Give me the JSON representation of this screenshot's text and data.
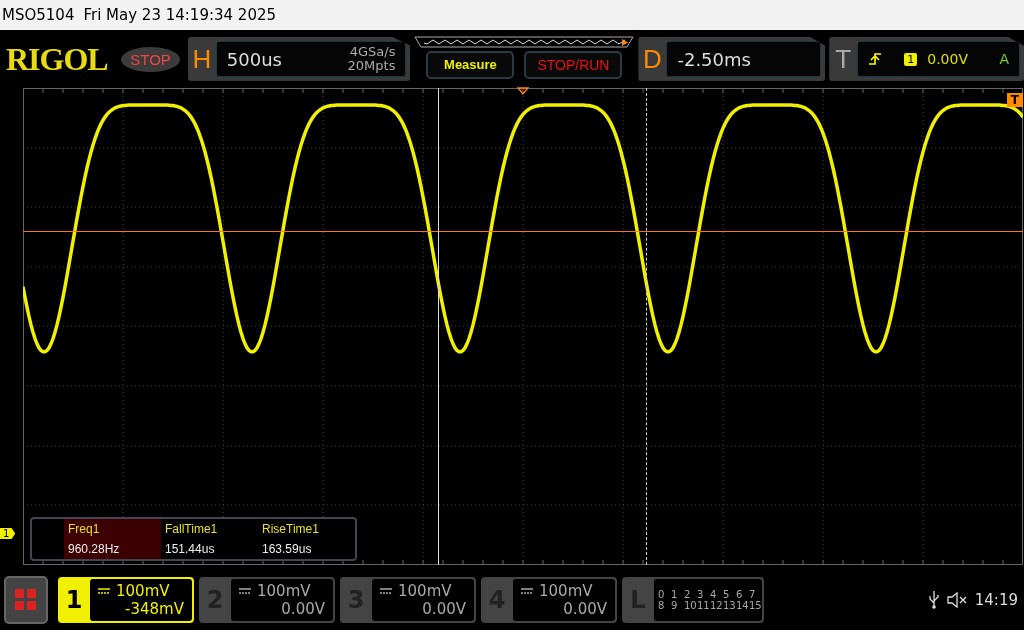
{
  "title_bar": {
    "model": "MSO5104",
    "datetime": "Fri May 23 14:19:34 2025"
  },
  "header": {
    "logo": "RIGOL",
    "run_state": "STOP",
    "horizontal": {
      "label": "H",
      "timebase": "500us",
      "sample_rate": "4GSa/s",
      "memory": "20Mpts"
    },
    "measure_button": "Measure",
    "stop_run_button": "STOP/RUN",
    "delay": {
      "label": "D",
      "value": "-2.50ms"
    },
    "trigger": {
      "label": "T",
      "source": "1",
      "level": "0.00V",
      "mode": "A"
    }
  },
  "screen": {
    "channel_marker": "1",
    "trigger_marker": "T"
  },
  "measurements": [
    {
      "name": "Freq1",
      "value": "960.28Hz",
      "selected": true
    },
    {
      "name": "FallTime1",
      "value": "151.44us",
      "selected": false
    },
    {
      "name": "RiseTime1",
      "value": "163.59us",
      "selected": false
    }
  ],
  "channels": [
    {
      "number": "1",
      "scale": "100mV",
      "offset": "-348mV",
      "active": true
    },
    {
      "number": "2",
      "scale": "100mV",
      "offset": "0.00V",
      "active": false
    },
    {
      "number": "3",
      "scale": "100mV",
      "offset": "0.00V",
      "active": false
    },
    {
      "number": "4",
      "scale": "100mV",
      "offset": "0.00V",
      "active": false
    }
  ],
  "logic": {
    "label": "L",
    "rows": [
      [
        "0",
        "1",
        "2",
        "3",
        "4",
        "5",
        "6",
        "7"
      ],
      [
        "8",
        "9",
        "10",
        "11",
        "12",
        "13",
        "14",
        "15"
      ]
    ]
  },
  "status": {
    "clock": "14:19"
  }
}
